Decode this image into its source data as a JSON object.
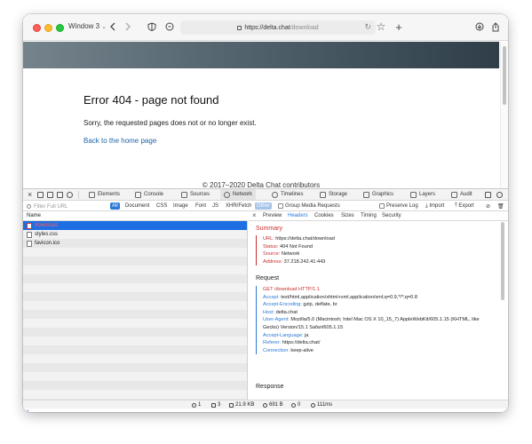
{
  "window": {
    "title": "Window 3",
    "url_host": "https://delta.chat",
    "url_path": "/download"
  },
  "page": {
    "error_title": "Error 404 - page not found",
    "error_text": "Sorry, the requested pages does not or no longer exist.",
    "home_link": "Back to the home page",
    "footer": "© 2017–2020 Delta Chat contributors"
  },
  "devtools": {
    "tabs": [
      "Elements",
      "Console",
      "Sources",
      "Network",
      "Timelines",
      "Storage",
      "Graphics",
      "Layers",
      "Audit"
    ],
    "active_tab": "Network",
    "filter_placeholder": "Filter Full URL",
    "filters": [
      "All",
      "Document",
      "CSS",
      "Image",
      "Font",
      "JS",
      "XHR/Fetch",
      "Other"
    ],
    "group_media": "Group Media Requests",
    "preserve_log": "Preserve Log",
    "import": "Import",
    "export": "Export",
    "column_name": "Name",
    "requests": [
      "download",
      "styles.css",
      "favicon.ico"
    ],
    "detail_tabs": [
      "Preview",
      "Headers",
      "Cookies",
      "Sizes",
      "Timing",
      "Security"
    ],
    "active_detail_tab": "Headers",
    "summary_title": "Summary",
    "summary": [
      {
        "k": "URL:",
        "v": " https://delta.chat/download"
      },
      {
        "k": "Status:",
        "v": " 404 Not Found"
      },
      {
        "k": "Source:",
        "v": " Network"
      },
      {
        "k": "Address:",
        "v": " 37.218.242.41:443"
      }
    ],
    "request_title": "Request",
    "request_line": "GET /download HTTP/1.1",
    "request_headers": [
      {
        "k": "Accept:",
        "v": " text/html,application/xhtml+xml,application/xml;q=0.9,*/*;q=0.8"
      },
      {
        "k": "Accept-Encoding:",
        "v": " gzip, deflate, br"
      },
      {
        "k": "Host:",
        "v": " delta.chat"
      },
      {
        "k": "User-Agent:",
        "v": " Mozilla/5.0 (Macintosh; Intel Mac OS X 10_15_7) AppleWebKit/605.1.15 (KHTML, like Gecko) Version/15.1 Safari/605.1.15"
      },
      {
        "k": "Accept-Language:",
        "v": " ja"
      },
      {
        "k": "Referer:",
        "v": " https://delta.chat/"
      },
      {
        "k": "Connection:",
        "v": " keep-alive"
      }
    ],
    "response_title": "Response",
    "status": {
      "requests": "1",
      "pages": "3",
      "transferred": "21.9 KB",
      "resources": "691 B",
      "errors": "0",
      "time": "111ms"
    }
  },
  "colors": {
    "accent": "#2a79d5",
    "error": "#c92d2d",
    "selected_row": "#1d6ee3"
  }
}
